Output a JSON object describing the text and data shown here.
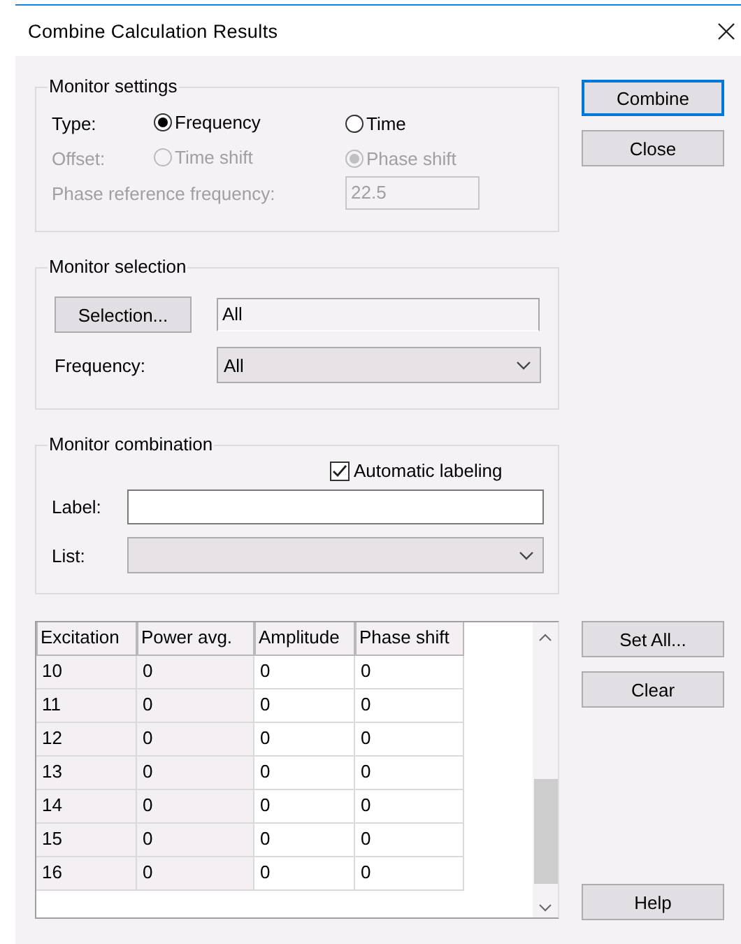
{
  "window": {
    "title": "Combine Calculation Results"
  },
  "monitor_settings": {
    "title": "Monitor settings",
    "type": {
      "label": "Type:",
      "disabled": false,
      "options": [
        {
          "label": "Frequency",
          "selected": true
        },
        {
          "label": "Time",
          "selected": false
        }
      ]
    },
    "offset": {
      "label": "Offset:",
      "disabled": true,
      "options": [
        {
          "label": "Time shift",
          "selected": false
        },
        {
          "label": "Phase shift",
          "selected": true
        }
      ]
    },
    "phase_reference_frequency": {
      "label": "Phase reference frequency:",
      "value": "22.5",
      "disabled": true
    }
  },
  "monitor_selection": {
    "title": "Monitor selection",
    "selection_button": "Selection...",
    "selection_value": "All",
    "frequency": {
      "label": "Frequency:",
      "value": "All"
    }
  },
  "monitor_combination": {
    "title": "Monitor combination",
    "automatic_labeling": {
      "label": "Automatic labeling",
      "checked": true
    },
    "label_field": {
      "label": "Label:"
    },
    "list": {
      "label": "List:"
    }
  },
  "table": {
    "columns": [
      {
        "label": "Excitation",
        "editable": false
      },
      {
        "label": "Power avg.",
        "editable": false
      },
      {
        "label": "Amplitude",
        "editable": true
      },
      {
        "label": "Phase shift",
        "editable": true
      }
    ],
    "rows": [
      [
        "10",
        "0",
        "0",
        "0"
      ],
      [
        "11",
        "0",
        "0",
        "0"
      ],
      [
        "12",
        "0",
        "0",
        "0"
      ],
      [
        "13",
        "0",
        "0",
        "0"
      ],
      [
        "14",
        "0",
        "0",
        "0"
      ],
      [
        "15",
        "0",
        "0",
        "0"
      ],
      [
        "16",
        "0",
        "0",
        "0"
      ]
    ]
  },
  "buttons_top": [
    {
      "label": "Combine",
      "default": true
    },
    {
      "label": "Close",
      "default": false
    }
  ],
  "buttons_table": [
    {
      "label": "Set All...",
      "default": false
    },
    {
      "label": "Clear",
      "default": false
    }
  ],
  "help_button": {
    "label": "Help",
    "default": false
  }
}
